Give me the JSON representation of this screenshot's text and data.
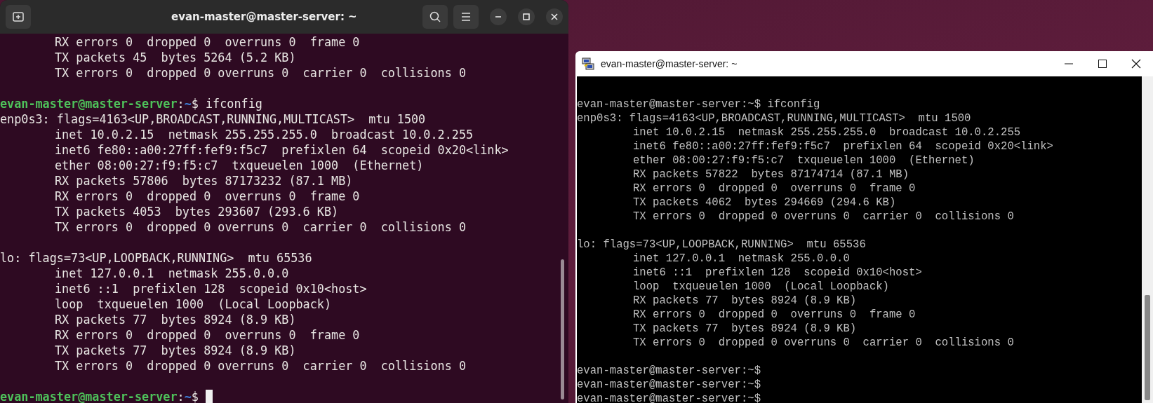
{
  "left_terminal": {
    "title": "evan-master@master-server: ~",
    "cursor_visible": true,
    "lines": [
      {
        "kind": "detail",
        "text": "RX errors 0  dropped 0  overruns 0  frame 0"
      },
      {
        "kind": "detail",
        "text": "TX packets 45  bytes 5264 (5.2 KB)"
      },
      {
        "kind": "detail",
        "text": "TX errors 0  dropped 0 overruns 0  carrier 0  collisions 0"
      },
      {
        "kind": "blank"
      },
      {
        "kind": "prompt",
        "user": "evan-master@master-server",
        "sep": ":",
        "path": "~",
        "symbol": "$",
        "command": "ifconfig"
      },
      {
        "kind": "header",
        "text": "enp0s3: flags=4163<UP,BROADCAST,RUNNING,MULTICAST>  mtu 1500"
      },
      {
        "kind": "detail",
        "text": "inet 10.0.2.15  netmask 255.255.255.0  broadcast 10.0.2.255"
      },
      {
        "kind": "detail",
        "text": "inet6 fe80::a00:27ff:fef9:f5c7  prefixlen 64  scopeid 0x20<link>"
      },
      {
        "kind": "detail",
        "text": "ether 08:00:27:f9:f5:c7  txqueuelen 1000  (Ethernet)"
      },
      {
        "kind": "detail",
        "text": "RX packets 57806  bytes 87173232 (87.1 MB)"
      },
      {
        "kind": "detail",
        "text": "RX errors 0  dropped 0  overruns 0  frame 0"
      },
      {
        "kind": "detail",
        "text": "TX packets 4053  bytes 293607 (293.6 KB)"
      },
      {
        "kind": "detail",
        "text": "TX errors 0  dropped 0 overruns 0  carrier 0  collisions 0"
      },
      {
        "kind": "blank"
      },
      {
        "kind": "header",
        "text": "lo: flags=73<UP,LOOPBACK,RUNNING>  mtu 65536"
      },
      {
        "kind": "detail",
        "text": "inet 127.0.0.1  netmask 255.0.0.0"
      },
      {
        "kind": "detail",
        "text": "inet6 ::1  prefixlen 128  scopeid 0x10<host>"
      },
      {
        "kind": "detail",
        "text": "loop  txqueuelen 1000  (Local Loopback)"
      },
      {
        "kind": "detail",
        "text": "RX packets 77  bytes 8924 (8.9 KB)"
      },
      {
        "kind": "detail",
        "text": "RX errors 0  dropped 0  overruns 0  frame 0"
      },
      {
        "kind": "detail",
        "text": "TX packets 77  bytes 8924 (8.9 KB)"
      },
      {
        "kind": "detail",
        "text": "TX errors 0  dropped 0 overruns 0  carrier 0  collisions 0"
      },
      {
        "kind": "blank"
      },
      {
        "kind": "prompt",
        "user": "evan-master@master-server",
        "sep": ":",
        "path": "~",
        "symbol": "$"
      }
    ]
  },
  "right_terminal": {
    "title": "evan-master@master-server: ~",
    "lines": [
      {
        "kind": "blank"
      },
      {
        "kind": "header",
        "text": "evan-master@master-server:~$ ifconfig"
      },
      {
        "kind": "header",
        "text": "enp0s3: flags=4163<UP,BROADCAST,RUNNING,MULTICAST>  mtu 1500"
      },
      {
        "kind": "detail",
        "text": "inet 10.0.2.15  netmask 255.255.255.0  broadcast 10.0.2.255"
      },
      {
        "kind": "detail",
        "text": "inet6 fe80::a00:27ff:fef9:f5c7  prefixlen 64  scopeid 0x20<link>"
      },
      {
        "kind": "detail",
        "text": "ether 08:00:27:f9:f5:c7  txqueuelen 1000  (Ethernet)"
      },
      {
        "kind": "detail",
        "text": "RX packets 57822  bytes 87174714 (87.1 MB)"
      },
      {
        "kind": "detail",
        "text": "RX errors 0  dropped 0  overruns 0  frame 0"
      },
      {
        "kind": "detail",
        "text": "TX packets 4062  bytes 294669 (294.6 KB)"
      },
      {
        "kind": "detail",
        "text": "TX errors 0  dropped 0 overruns 0  carrier 0  collisions 0"
      },
      {
        "kind": "blank"
      },
      {
        "kind": "header",
        "text": "lo: flags=73<UP,LOOPBACK,RUNNING>  mtu 65536"
      },
      {
        "kind": "detail",
        "text": "inet 127.0.0.1  netmask 255.0.0.0"
      },
      {
        "kind": "detail",
        "text": "inet6 ::1  prefixlen 128  scopeid 0x10<host>"
      },
      {
        "kind": "detail",
        "text": "loop  txqueuelen 1000  (Local Loopback)"
      },
      {
        "kind": "detail",
        "text": "RX packets 77  bytes 8924 (8.9 KB)"
      },
      {
        "kind": "detail",
        "text": "RX errors 0  dropped 0  overruns 0  frame 0"
      },
      {
        "kind": "detail",
        "text": "TX packets 77  bytes 8924 (8.9 KB)"
      },
      {
        "kind": "detail",
        "text": "TX errors 0  dropped 0 overruns 0  carrier 0  collisions 0"
      },
      {
        "kind": "blank"
      },
      {
        "kind": "header",
        "text": "evan-master@master-server:~$"
      },
      {
        "kind": "header",
        "text": "evan-master@master-server:~$"
      },
      {
        "kind": "header",
        "text": "evan-master@master-server:~$"
      }
    ]
  }
}
